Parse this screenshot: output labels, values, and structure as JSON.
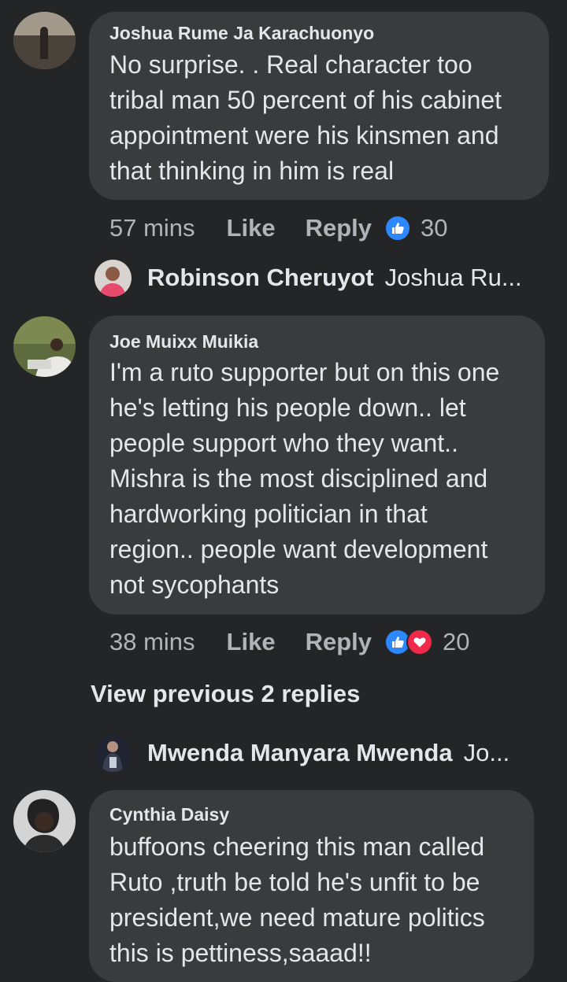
{
  "comments": [
    {
      "author": "Joshua Rume Ja Karachuonyo",
      "text": "No surprise.  . Real character too\ntribal man 50 percent of his cabinet\nappointment were his kinsmen and\nthat thinking in him is real",
      "time": "57 mins",
      "like_label": "Like",
      "reply_label": "Reply",
      "reaction_count": "30",
      "reactions": [
        "like-icon"
      ]
    },
    {
      "author": "Joe Muixx Muikia",
      "text": "I'm a ruto supporter but on this one\nhe's letting his people down.. let\npeople support who they want..\nMishra is the most disciplined and\nhardworking politician in that\nregion.. people want development\nnot sycophants",
      "time": "38 mins",
      "like_label": "Like",
      "reply_label": "Reply",
      "reaction_count": "20",
      "reactions": [
        "like-icon",
        "love-icon"
      ]
    },
    {
      "author": "Cynthia Daisy",
      "text": "buffoons cheering this man called\nRuto ,truth be told he's unfit to be\npresident,we need mature politics\nthis is pettiness,saaad!!"
    }
  ],
  "replies": [
    {
      "author": "Robinson Cheruyot",
      "preview": "Joshua Ru..."
    },
    {
      "author": "Mwenda Manyara Mwenda",
      "preview": "Jo..."
    }
  ],
  "view_previous_label": "View previous 2 replies",
  "colors": {
    "background": "#242526",
    "bubble": "#3a3b3c",
    "text": "#e4e6eb",
    "secondary_text": "#b0b3b8",
    "like_blue": "#2d88ff",
    "love_red": "#f0284a"
  }
}
